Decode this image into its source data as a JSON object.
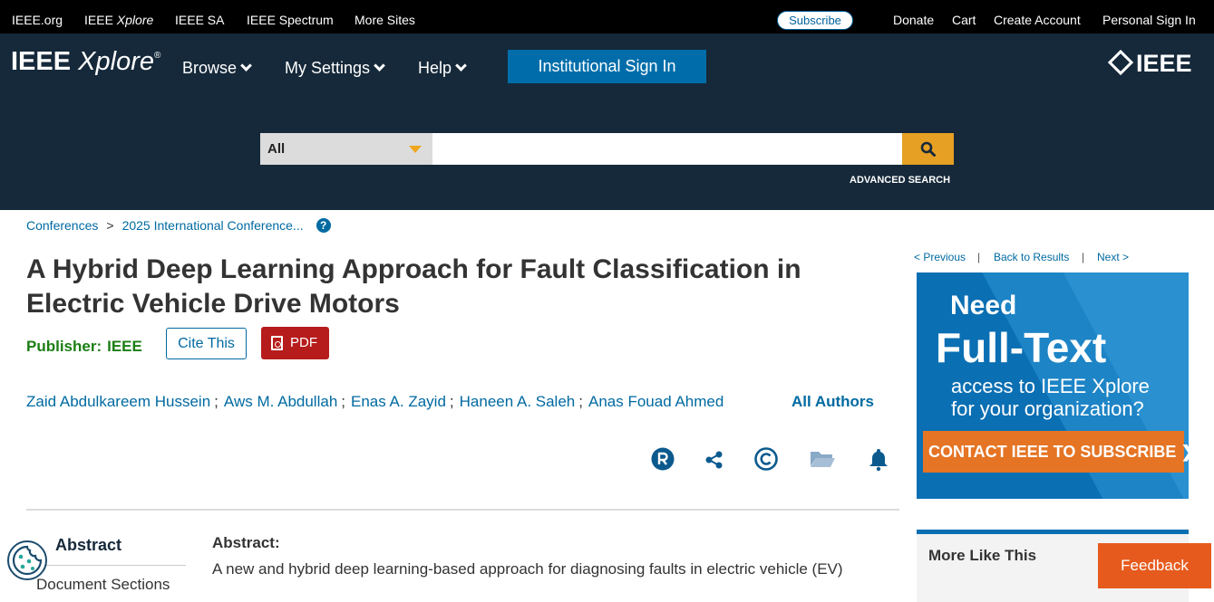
{
  "topbar": {
    "links": [
      "IEEE.org",
      "IEEE Xplore",
      "IEEE SA",
      "IEEE Spectrum",
      "More Sites"
    ],
    "subscribe": "Subscribe",
    "right_links": [
      "Donate",
      "Cart",
      "Create Account",
      "Personal Sign In"
    ]
  },
  "header": {
    "logo_main": "IEEE",
    "logo_italic": "Xplore",
    "logo_reg": "®",
    "nav": [
      "Browse",
      "My Settings",
      "Help"
    ],
    "institutional": "Institutional Sign In",
    "brand": "IEEE"
  },
  "search": {
    "category": "All",
    "placeholder": "",
    "advanced": "ADVANCED SEARCH"
  },
  "breadcrumb": {
    "items": [
      "Conferences",
      "2025 International Conference..."
    ],
    "separator": ">",
    "help_icon": "?"
  },
  "article": {
    "title": "A Hybrid Deep Learning Approach for Fault Classification in Electric Vehicle Drive Motors",
    "publisher_label": "Publisher:",
    "publisher_value": "IEEE",
    "cite": "Cite This",
    "pdf": "PDF",
    "authors": [
      "Zaid Abdulkareem Hussein",
      "Aws M. Abdullah",
      "Enas A. Zayid",
      "Haneen A. Saleh",
      "Anas Fouad Ahmed"
    ],
    "author_separator": ";",
    "all_authors": "All Authors",
    "tools": [
      "rights-icon",
      "share-icon",
      "copyright-icon",
      "folder-icon",
      "bell-icon"
    ]
  },
  "sections": {
    "tab_abstract": "Abstract",
    "tab_document_sections": "Document Sections",
    "abstract_heading": "Abstract:",
    "abstract_text": "A new and hybrid deep learning-based approach for diagnosing faults in electric vehicle (EV)"
  },
  "pager": {
    "previous": "< Previous",
    "back": "Back to Results",
    "next": "Next >",
    "separator": "|"
  },
  "ad": {
    "need": "Need",
    "full_text": "Full-Text",
    "access_line1": "access to IEEE Xplore",
    "access_line2": "for your organization?",
    "cta": "CONTACT IEEE TO SUBSCRIBE ❯"
  },
  "more_like_this": "More Like This",
  "feedback": "Feedback",
  "colors": {
    "header_bg": "#16293a",
    "link": "#006aa1",
    "publisher": "#1b7e14",
    "pdf": "#b71c1c",
    "search_button": "#e6a023",
    "feedback": "#e65b1d"
  }
}
